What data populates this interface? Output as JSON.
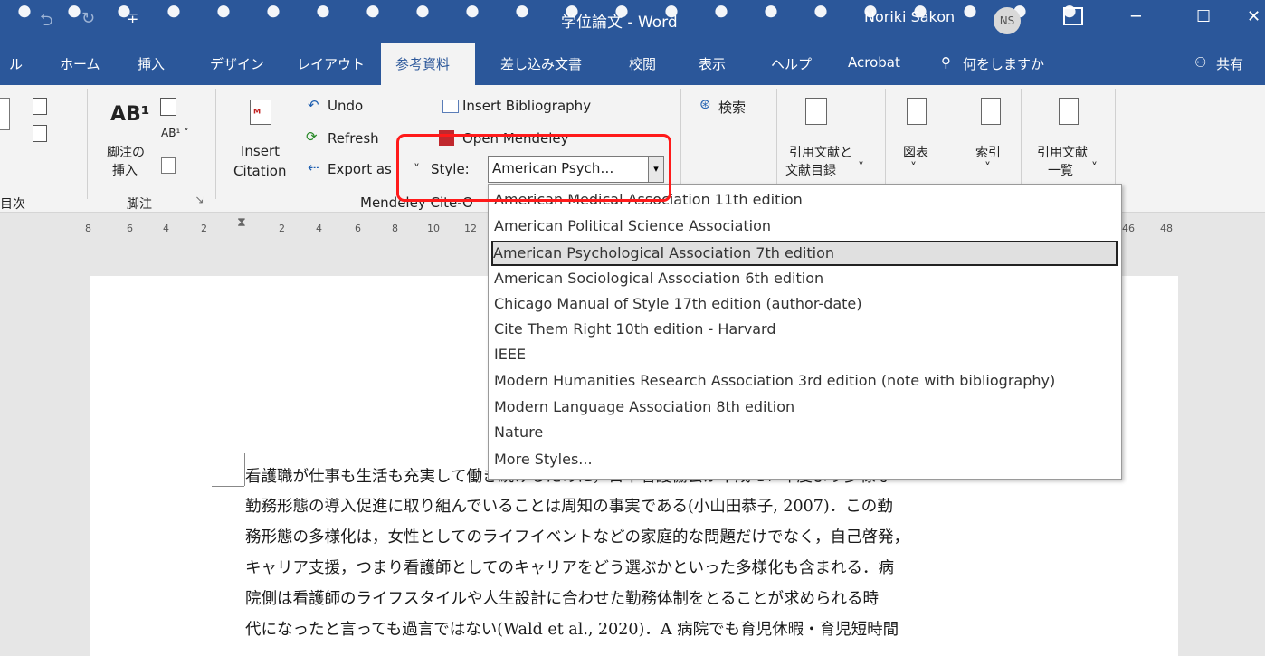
{
  "overlay": {
    "text": "・・・・・・・・・・・・・・・・・・・・・・"
  },
  "titlebar": {
    "title": "学位論文 - Word",
    "user": "Noriki Sakon",
    "initials": "NS",
    "minimize": "─",
    "restore": "☐",
    "close": "✕",
    "undo_icon": "⮌",
    "redo_icon": "↻",
    "qa": "∓"
  },
  "tabs": [
    {
      "label": "ル"
    },
    {
      "label": "ホーム"
    },
    {
      "label": "挿入"
    },
    {
      "label": "デザイン"
    },
    {
      "label": "レイアウト"
    },
    {
      "label": "参考資料"
    },
    {
      "label": "差し込み文書"
    },
    {
      "label": "校閲"
    },
    {
      "label": "表示"
    },
    {
      "label": "ヘルプ"
    },
    {
      "label": "Acrobat"
    }
  ],
  "tell_me": "何をしますか",
  "share": "共有",
  "ribbon": {
    "toc_group": "目次",
    "footnote_btn_1": "脚注の",
    "footnote_btn_2": "挿入",
    "footnote_group": "脚注",
    "insert_citation_1": "Insert",
    "insert_citation_2": "Citation",
    "undo": "Undo",
    "refresh": "Refresh",
    "export_as": "Export as",
    "insert_bibliography": "Insert Bibliography",
    "open_mendeley": "Open Mendeley",
    "style_label": "Style:",
    "style_value": "American Psych…",
    "mendeley_group": "Mendeley Cite-O",
    "search": "検索",
    "citations_1": "引用文献と",
    "citations_2": "文献目録",
    "captions": "図表",
    "index": "索引",
    "toa_1": "引用文献",
    "toa_2": "一覧"
  },
  "ruler": {
    "left": [
      "8",
      "6",
      "4",
      "2"
    ],
    "right": [
      "2",
      "4",
      "6",
      "8",
      "10",
      "12"
    ],
    "far": [
      "46",
      "48"
    ]
  },
  "style_dropdown": {
    "items": [
      "American Medical Association 11th edition",
      "American Political Science Association",
      "American Psychological Association 7th edition",
      "American Sociological Association 6th edition",
      "Chicago Manual of Style 17th edition (author-date)",
      "Cite Them Right 10th edition - Harvard",
      "IEEE",
      "Modern Humanities Research Association 3rd edition (note with bibliography)",
      "Modern Language Association 8th edition",
      "Nature",
      "More Styles..."
    ],
    "selected_index": 2
  },
  "document": {
    "lines": [
      "看護職が仕事も生活も充実して働き続けるために，日本看護協会が平成 17 年度より多様な",
      "勤務形態の導入促進に取り組んでいることは周知の事実である(小山田恭子, 2007)．この勤",
      "務形態の多様化は，女性としてのライフイベントなどの家庭的な問題だけでなく，自己啓発，",
      "キャリア支援，つまり看護師としてのキャリアをどう選ぶかといった多様化も含まれる．病",
      "院側は看護師のライフスタイルや人生設計に合わせた勤務体制をとることが求められる時",
      "代になったと言っても過言ではない(Wald et al., 2020)．A 病院でも育児休暇・育児短時間"
    ]
  },
  "colors": {
    "word_blue": "#2b579a",
    "highlight_red": "#ff1a1a"
  }
}
